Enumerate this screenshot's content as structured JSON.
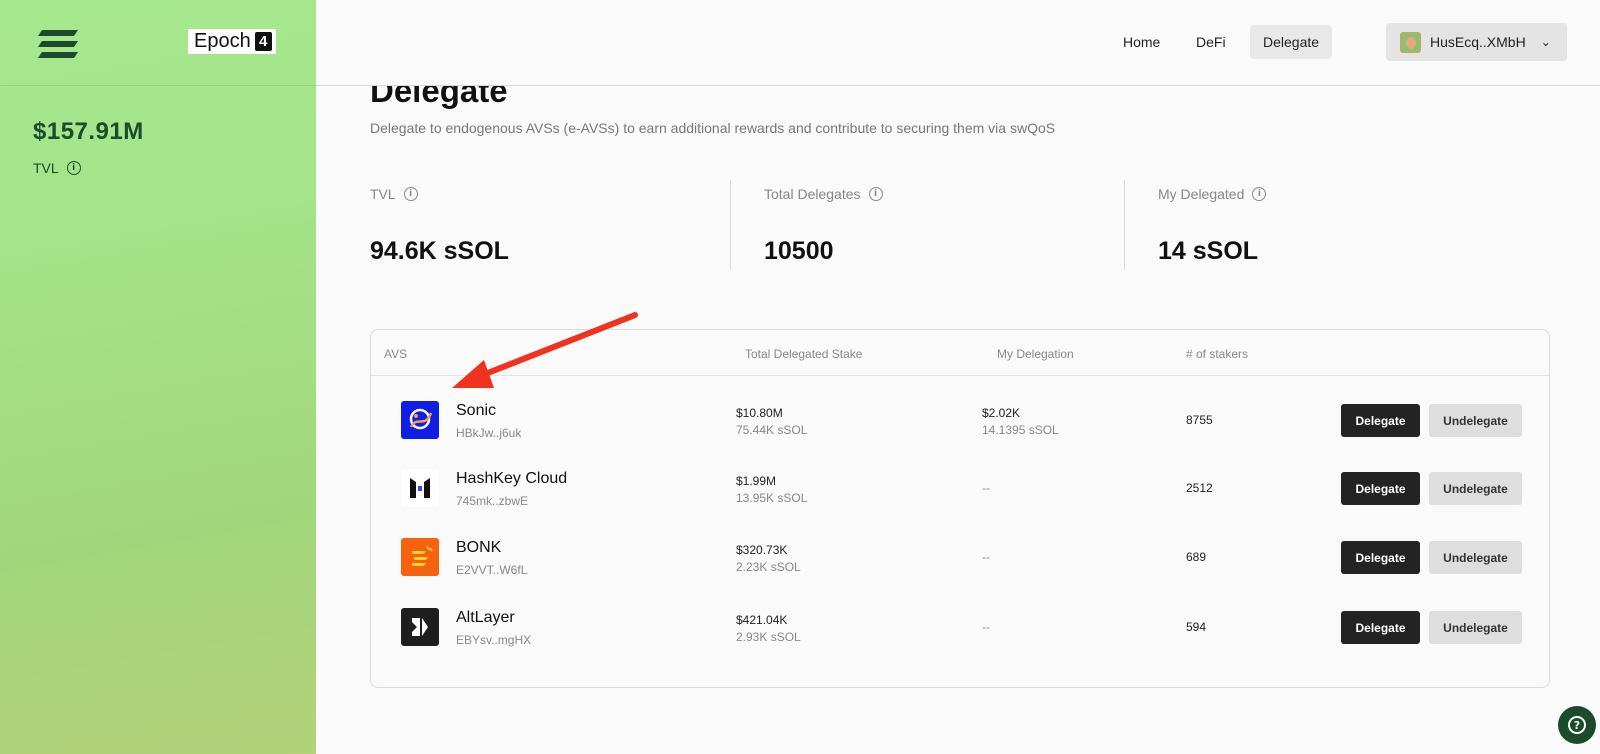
{
  "sidebar": {
    "epoch_label": "Epoch",
    "epoch_number": "4",
    "tvl_value": "$157.91M",
    "tvl_label": "TVL"
  },
  "nav": {
    "home": "Home",
    "defi": "DeFi",
    "delegate": "Delegate",
    "wallet_address": "HusEcq..XMbH"
  },
  "page": {
    "title": "Delegate",
    "subtitle": "Delegate to endogenous AVSs (e-AVSs) to earn additional rewards and contribute to securing them via swQoS"
  },
  "stats": [
    {
      "label": "TVL",
      "value": "94.6K sSOL"
    },
    {
      "label": "Total Delegates",
      "value": "10500"
    },
    {
      "label": "My Delegated",
      "value": "14 sSOL"
    }
  ],
  "table": {
    "headers": {
      "avs": "AVS",
      "total_stake": "Total Delegated Stake",
      "my_delegation": "My Delegation",
      "stakers": "# of stakers"
    },
    "delegate_label": "Delegate",
    "undelegate_label": "Undelegate",
    "rows": [
      {
        "name": "Sonic",
        "address": "HBkJw..j6uk",
        "total_usd": "$10.80M",
        "total_ssol": "75.44K sSOL",
        "my_usd": "$2.02K",
        "my_ssol": "14.1395 sSOL",
        "stakers": "8755",
        "icon": "sonic-logo"
      },
      {
        "name": "HashKey Cloud",
        "address": "745mk..zbwE",
        "total_usd": "$1.99M",
        "total_ssol": "13.95K sSOL",
        "my_delegation": "--",
        "stakers": "2512",
        "icon": "hashkey-logo"
      },
      {
        "name": "BONK",
        "address": "E2VVT..W6fL",
        "total_usd": "$320.73K",
        "total_ssol": "2.23K sSOL",
        "my_delegation": "--",
        "stakers": "689",
        "icon": "bonk-logo"
      },
      {
        "name": "AltLayer",
        "address": "EBYsv..mgHX",
        "total_usd": "$421.04K",
        "total_ssol": "2.93K sSOL",
        "my_delegation": "--",
        "stakers": "594",
        "icon": "altlayer-logo"
      }
    ]
  },
  "colors": {
    "sidebar_green": "#a6e88e",
    "dark_green": "#1b4a2c",
    "annotation_arrow": "#f0321e",
    "sonic_blue": "#0f1ee6",
    "bonk_orange": "#f7620f"
  }
}
